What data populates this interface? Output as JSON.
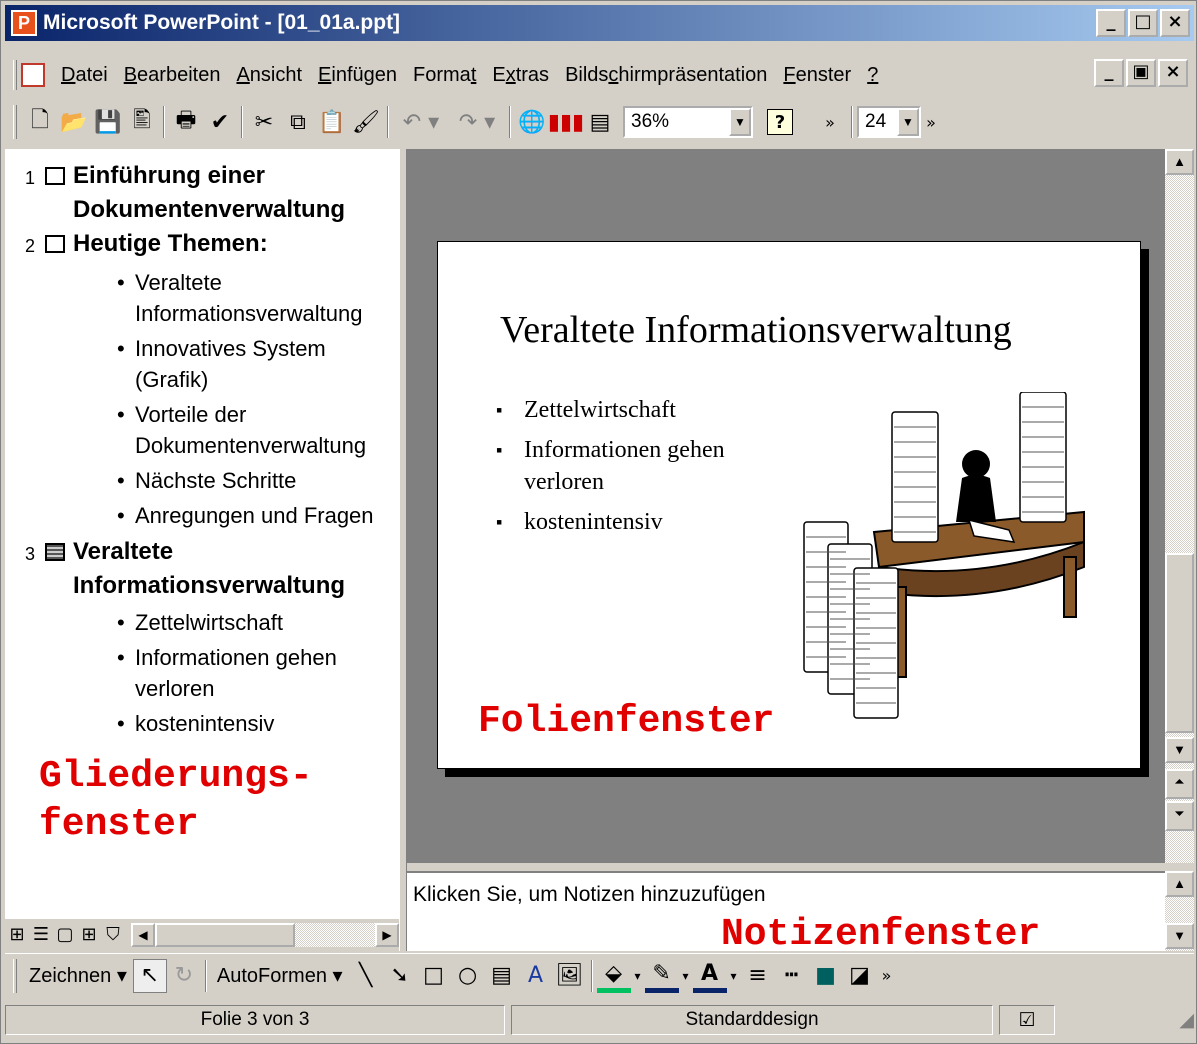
{
  "window": {
    "title": "Microsoft PowerPoint - [01_01a.ppt]",
    "app_icon": "powerpoint-icon"
  },
  "caption_buttons": [
    "_",
    "□",
    "×"
  ],
  "mdi_buttons": [
    "_",
    "▣",
    "×"
  ],
  "menu": [
    {
      "pre": "",
      "ul": "D",
      "post": "atei"
    },
    {
      "pre": "",
      "ul": "B",
      "post": "earbeiten"
    },
    {
      "pre": "",
      "ul": "A",
      "post": "nsicht"
    },
    {
      "pre": "",
      "ul": "E",
      "post": "infügen"
    },
    {
      "pre": "Forma",
      "ul": "t",
      "post": ""
    },
    {
      "pre": "E",
      "ul": "x",
      "post": "tras"
    },
    {
      "pre": "Bilds",
      "ul": "c",
      "post": "hirmpräsentation"
    },
    {
      "pre": "",
      "ul": "F",
      "post": "enster"
    },
    {
      "pre": "",
      "ul": "?",
      "post": ""
    }
  ],
  "toolbar": {
    "icons": [
      "new-icon",
      "open-icon",
      "save-icon",
      "permission-icon",
      "print-icon",
      "spelling-icon",
      "cut-icon",
      "copy-icon",
      "paste-icon",
      "format-painter-icon",
      "undo-icon",
      "redo-icon",
      "hyperlink-icon",
      "chart-icon",
      "new-slide-icon"
    ],
    "zoom": "36%",
    "help": "?",
    "font_size": "24"
  },
  "outline": {
    "slides": [
      {
        "num": "1",
        "title": "Einführung einer Dokumentenverwaltung",
        "bullets": []
      },
      {
        "num": "2",
        "title": "Heutige Themen:",
        "bullets": [
          "Veraltete Informationsverwaltung",
          "Innovatives System (Grafik)",
          "Vorteile der Dokumentenverwaltung",
          "Nächste Schritte",
          "Anregungen und Fragen"
        ]
      },
      {
        "num": "3",
        "title": "Veraltete Informationsverwaltung",
        "bullets": [
          "Zettelwirtschaft",
          "Informationen gehen verloren",
          "kostenintensiv"
        ]
      }
    ],
    "label_line1": "Gliederungs-",
    "label_line2": "fenster"
  },
  "slide": {
    "title": "Veraltete Informationsverwaltung",
    "bullets": [
      "Zettelwirtschaft",
      "Informationen gehen verloren",
      "kostenintensiv"
    ],
    "label": "Folienfenster"
  },
  "notes": {
    "placeholder": "Klicken Sie, um Notizen hinzuzufügen",
    "label": "Notizenfenster"
  },
  "drawing": {
    "zeichnen": "Zeichnen",
    "autoformen": "AutoFormen"
  },
  "status": {
    "slide": "Folie 3 von 3",
    "design": "Standarddesign"
  },
  "colors": {
    "title_bar": "#0a246a",
    "label_red": "#e00000",
    "desk": "#8b5a2b"
  }
}
